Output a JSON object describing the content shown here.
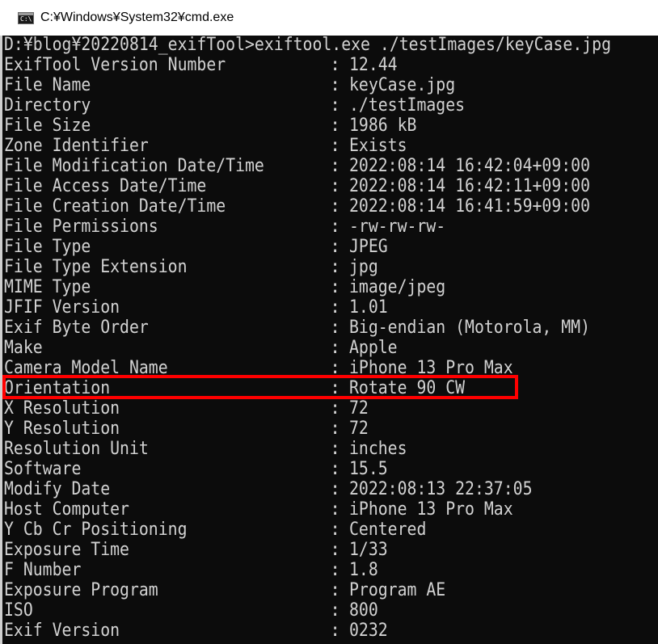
{
  "window": {
    "title": "C:¥Windows¥System32¥cmd.exe",
    "icon": "cmd-icon",
    "icon_glyph": "C:\\"
  },
  "console": {
    "prompt_line": "D:¥blog¥20220814_exifTool>exiftool.exe ./testImages/keyCase.jpg",
    "rows": [
      {
        "tag": "ExifTool Version Number",
        "value": "12.44"
      },
      {
        "tag": "File Name",
        "value": "keyCase.jpg"
      },
      {
        "tag": "Directory",
        "value": "./testImages"
      },
      {
        "tag": "File Size",
        "value": "1986 kB"
      },
      {
        "tag": "Zone Identifier",
        "value": "Exists"
      },
      {
        "tag": "File Modification Date/Time",
        "value": "2022:08:14 16:42:04+09:00"
      },
      {
        "tag": "File Access Date/Time",
        "value": "2022:08:14 16:42:11+09:00"
      },
      {
        "tag": "File Creation Date/Time",
        "value": "2022:08:14 16:41:59+09:00"
      },
      {
        "tag": "File Permissions",
        "value": "-rw-rw-rw-"
      },
      {
        "tag": "File Type",
        "value": "JPEG"
      },
      {
        "tag": "File Type Extension",
        "value": "jpg"
      },
      {
        "tag": "MIME Type",
        "value": "image/jpeg"
      },
      {
        "tag": "JFIF Version",
        "value": "1.01"
      },
      {
        "tag": "Exif Byte Order",
        "value": "Big-endian (Motorola, MM)"
      },
      {
        "tag": "Make",
        "value": "Apple"
      },
      {
        "tag": "Camera Model Name",
        "value": "iPhone 13 Pro Max"
      },
      {
        "tag": "Orientation",
        "value": "Rotate 90 CW"
      },
      {
        "tag": "X Resolution",
        "value": "72"
      },
      {
        "tag": "Y Resolution",
        "value": "72"
      },
      {
        "tag": "Resolution Unit",
        "value": "inches"
      },
      {
        "tag": "Software",
        "value": "15.5"
      },
      {
        "tag": "Modify Date",
        "value": "2022:08:13 22:37:05"
      },
      {
        "tag": "Host Computer",
        "value": "iPhone 13 Pro Max"
      },
      {
        "tag": "Y Cb Cr Positioning",
        "value": "Centered"
      },
      {
        "tag": "Exposure Time",
        "value": "1/33"
      },
      {
        "tag": "F Number",
        "value": "1.8"
      },
      {
        "tag": "Exposure Program",
        "value": "Program AE"
      },
      {
        "tag": "ISO",
        "value": "800"
      },
      {
        "tag": "Exif Version",
        "value": "0232"
      }
    ],
    "separator": ":",
    "highlighted_row": 16
  },
  "colors": {
    "console_background": "#0c0c0c",
    "console_text": "#d2d2d2",
    "highlight_border": "#ff0000"
  }
}
